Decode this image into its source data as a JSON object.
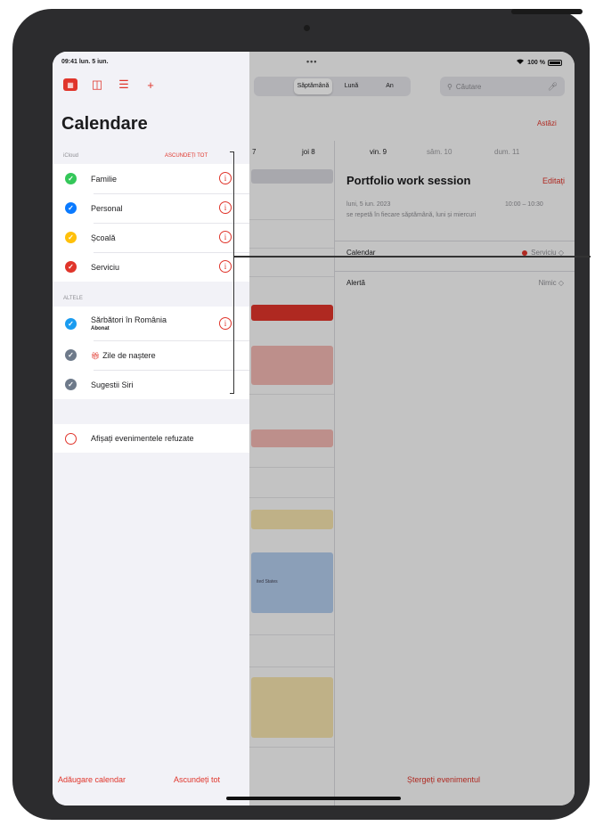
{
  "status_bar": {
    "time": "09:41 lun. 5 iun.",
    "dots": "•••",
    "battery": "100 %"
  },
  "view_switcher": {
    "items": [
      "",
      "Săptămână",
      "Lună",
      "An"
    ],
    "active_index": 1
  },
  "search": {
    "placeholder": "Căutare"
  },
  "today_button": "Astăzi",
  "day_headers": [
    {
      "label": "7",
      "muted": false
    },
    {
      "label": "joi 8",
      "muted": false
    },
    {
      "label": "vin. 9",
      "muted": false
    },
    {
      "label": "sâm. 10",
      "muted": true
    },
    {
      "label": "dum. 11",
      "muted": true
    }
  ],
  "event_detail": {
    "title": "Portfolio work session",
    "edit": "Editați",
    "date": "luni, 5 iun. 2023",
    "time": "10:00 – 10:30",
    "repeat": "se repetă în fiecare săptămână, luni și miercuri",
    "calendar_label": "Calendar",
    "calendar_value": "Serviciu ◇",
    "alert_label": "Alertă",
    "alert_value": "Nimic ◇",
    "delete": "Ștergeți evenimentul"
  },
  "background_events": [
    {
      "label": "ited States"
    }
  ],
  "sidebar": {
    "title": "Calendare",
    "icloud_header": "iCloud",
    "hide_all_top": "ASCUNDEȚI TOT",
    "icloud": [
      {
        "label": "Familie",
        "color": "#34c759"
      },
      {
        "label": "Personal",
        "color": "#0a7aff"
      },
      {
        "label": "Școală",
        "color": "#ffc00a"
      },
      {
        "label": "Serviciu",
        "color": "#e0352b"
      }
    ],
    "others_header": "ALTELE",
    "others": [
      {
        "label": "Sărbători în România",
        "sub": "Abonat",
        "color": "#1a9cf0",
        "info": true
      },
      {
        "label": "Zile de naștere",
        "color": "#6e7a8a",
        "gift": true,
        "info": false
      },
      {
        "label": "Sugestii Siri",
        "color": "#6e7a8a",
        "info": false
      }
    ],
    "show_declined": "Afișați evenimentele refuzate",
    "add_calendar": "Adăugare calendar",
    "hide_all": "Ascundeți tot"
  }
}
